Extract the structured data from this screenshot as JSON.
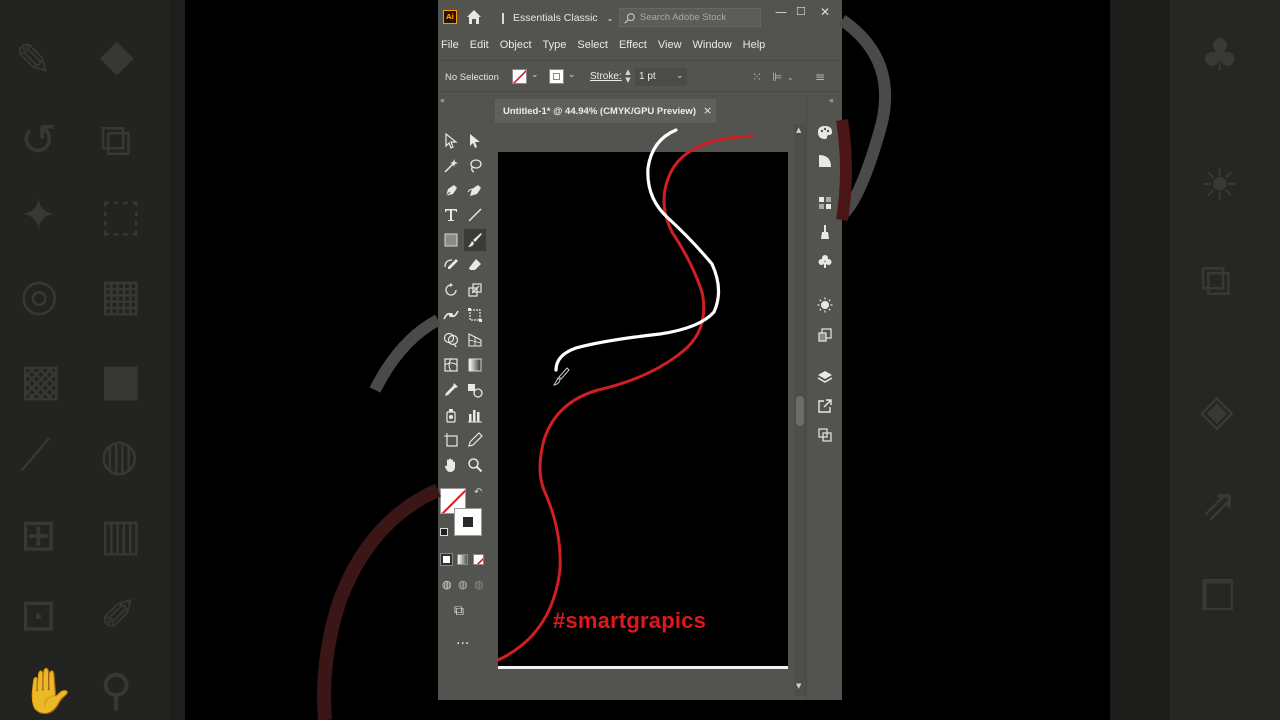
{
  "app": {
    "workspace": "Essentials Classic",
    "search_placeholder": "Search Adobe Stock",
    "window_controls": {
      "minimize": "—",
      "maximize": "☐",
      "close": "✕"
    },
    "logo_text": "Ai"
  },
  "menu": [
    "File",
    "Edit",
    "Object",
    "Type",
    "Select",
    "Effect",
    "View",
    "Window",
    "Help"
  ],
  "control_bar": {
    "selection": "No Selection",
    "stroke_label": "Stroke:",
    "stroke_value": "1 pt"
  },
  "document": {
    "tab_title": "Untitled-1* @ 44.94% (CMYK/GPU Preview)",
    "close": "×"
  },
  "overlay_text": "#smartgrapics",
  "colors": {
    "app_bg": "#535450",
    "artboard": "#000000",
    "red_stroke": "#d01f22",
    "white_stroke": "#ffffff",
    "hashtag": "#e0171b"
  },
  "tools": [
    "selection-tool",
    "direct-selection-tool",
    "magic-wand-tool",
    "lasso-tool",
    "pen-tool",
    "curvature-tool",
    "type-tool",
    "line-segment-tool",
    "rectangle-tool",
    "paintbrush-tool",
    "shaper-tool",
    "eraser-tool",
    "rotate-tool",
    "scale-tool",
    "width-tool",
    "free-transform-tool",
    "shape-builder-tool",
    "perspective-grid-tool",
    "mesh-tool",
    "gradient-tool",
    "eyedropper-tool",
    "blend-tool",
    "symbol-sprayer-tool",
    "column-graph-tool",
    "artboard-tool",
    "slice-tool",
    "hand-tool",
    "zoom-tool"
  ],
  "right_panel_icons": [
    "color-panel-icon",
    "color-guide-icon",
    "swatches-icon",
    "brushes-icon",
    "symbols-icon",
    "appearance-icon",
    "graphic-styles-icon",
    "layers-icon",
    "export-icon",
    "artboards-icon"
  ]
}
